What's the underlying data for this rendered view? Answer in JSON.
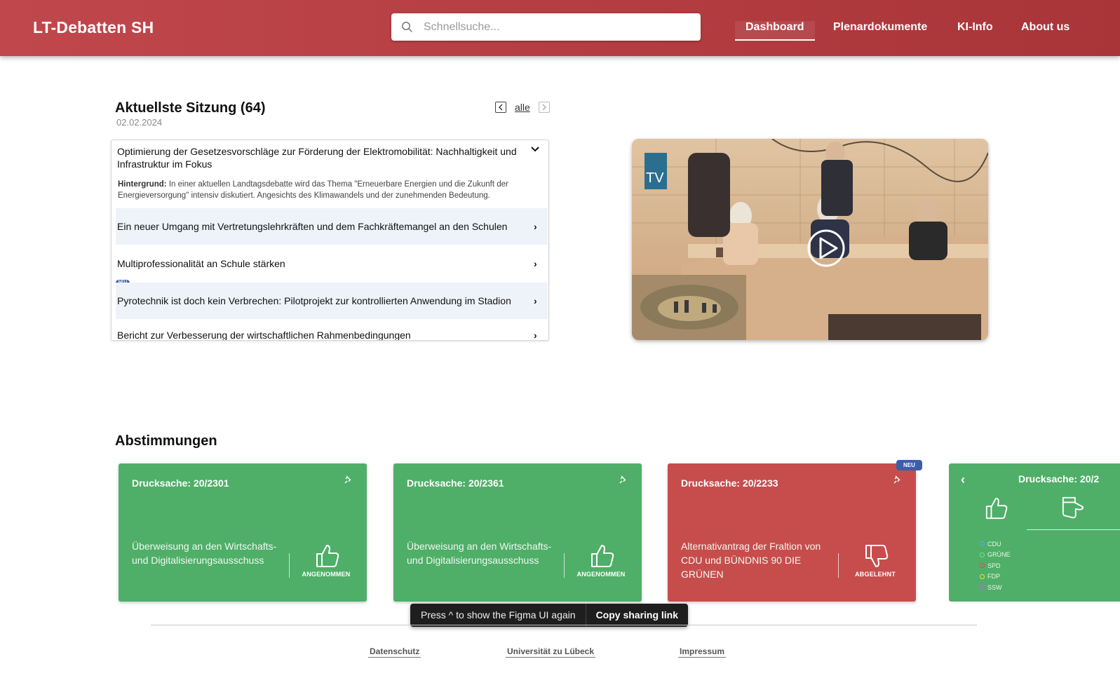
{
  "header": {
    "brand": "LT-Debatten SH",
    "search_placeholder": "Schnellsuche...",
    "nav": [
      "Dashboard",
      "Plenardokumente",
      "KI-Info",
      "About us"
    ]
  },
  "session": {
    "title": "Aktuellste Sitzung (64)",
    "date": "02.02.2024",
    "pager_all": "alle",
    "open_item": {
      "title": "Optimierung der Gesetzesvorschläge zur Förderung der Elektromobilität: Nachhaltigkeit und Infrastruktur im Fokus",
      "background_label": "Hintergrund:",
      "background_text": "In einer aktuellen Landtagsdebatte wird das Thema \"Erneuerbare Energien und die Zukunft der Energieversorgung\" intensiv diskutiert. Angesichts des Klimawandels und der zunehmenden Bedeutung."
    },
    "items": [
      {
        "title": "Ein neuer Umgang mit Vertretungslehrkräften und dem Fachkräftemangel an den Schulen"
      },
      {
        "title": "Multiprofessionalität an Schule stärken"
      },
      {
        "title": "Pyrotechnik ist doch kein Verbrechen: Pilotprojekt zur kontrollierten Anwendung im Stadion",
        "badge": "NEU"
      },
      {
        "title": "Bericht zur Verbesserung der wirtschaftlichen Rahmenbedingungen"
      }
    ]
  },
  "video": {
    "tv_label": "TV"
  },
  "votes": {
    "title": "Abstimmungen",
    "cards": [
      {
        "drucksache": "Drucksache: 20/2301",
        "description": "Überweisung an den Wirtschafts- und Digitalisierungsausschuss",
        "status": "ANGENOMMEN",
        "color": "#4faf68"
      },
      {
        "drucksache": "Drucksache: 20/2361",
        "description": "Überweisung an den Wirtschafts- und Digitalisierungsausschuss",
        "status": "ANGENOMMEN",
        "color": "#4faf68"
      },
      {
        "drucksache": "Drucksache: 20/2233",
        "description": "Alternativantrag der Fraltion von CDU und BÜNDNIS 90 DIE GRÜNEN",
        "status": "ABGELEHNT",
        "color": "#c74d4c",
        "badge": "NEU"
      }
    ],
    "detail_card": {
      "drucksache": "Drucksache: 20/2",
      "parties": [
        {
          "name": "CDU",
          "color": "#5aa8e8"
        },
        {
          "name": "GRÜNE",
          "color": "#7ddf8a"
        },
        {
          "name": "SPD",
          "color": "#f04848"
        },
        {
          "name": "FDP",
          "color": "#e8e04a"
        },
        {
          "name": "SSW",
          "color": "#c060e8"
        }
      ]
    }
  },
  "toast": {
    "message": "Press ^ to show the Figma UI again",
    "link": "Copy sharing link"
  },
  "footer": {
    "links": [
      "Datenschutz",
      "Universität zu Lübeck",
      "Impressum"
    ]
  }
}
